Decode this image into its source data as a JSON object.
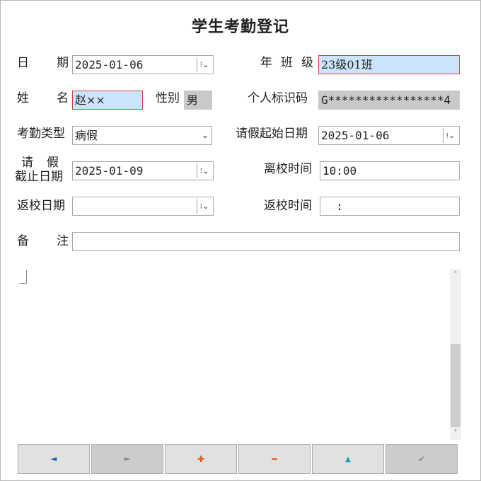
{
  "title": "学生考勤登记",
  "labels": {
    "date_a": "日",
    "date_b": "期",
    "class_a": "年",
    "class_b": "班",
    "class_c": "级",
    "name_a": "姓",
    "name_b": "名",
    "gender": "性别",
    "id_code": "个人标识码",
    "attendance_type": "考勤类型",
    "leave_start": "请假起始日期",
    "leave_end_1a": "请",
    "leave_end_1b": "假",
    "leave_end_2": "截止日期",
    "leave_time": "离校时间",
    "return_date": "返校日期",
    "return_time": "返校时间",
    "remark_a": "备",
    "remark_b": "注"
  },
  "values": {
    "date": "2025-01-06",
    "class": "23级01班",
    "name": "赵××",
    "gender": "男",
    "id_code": "G*****************4",
    "attendance_type": "病假",
    "leave_start": "2025-01-06",
    "leave_end": "2025-01-09",
    "leave_time": "10:00",
    "return_date": "",
    "return_time": "  :",
    "remark": ""
  },
  "icons": {
    "date_picker": "⁝⌄",
    "dropdown": "⌄",
    "scroll_up": "˄",
    "scroll_down": "˅"
  },
  "nav": {
    "first": "◄",
    "next": "►",
    "add": "✚",
    "delete": "━",
    "up": "▲",
    "confirm": "✔"
  },
  "colors": {
    "selected_bg": "#cce4fb",
    "required_border": "#d84040",
    "readonly_bg": "#c9c9c9",
    "nav_blue": "#1a5fc0",
    "nav_orange": "#e25a10",
    "nav_teal": "#1aa0b0"
  }
}
